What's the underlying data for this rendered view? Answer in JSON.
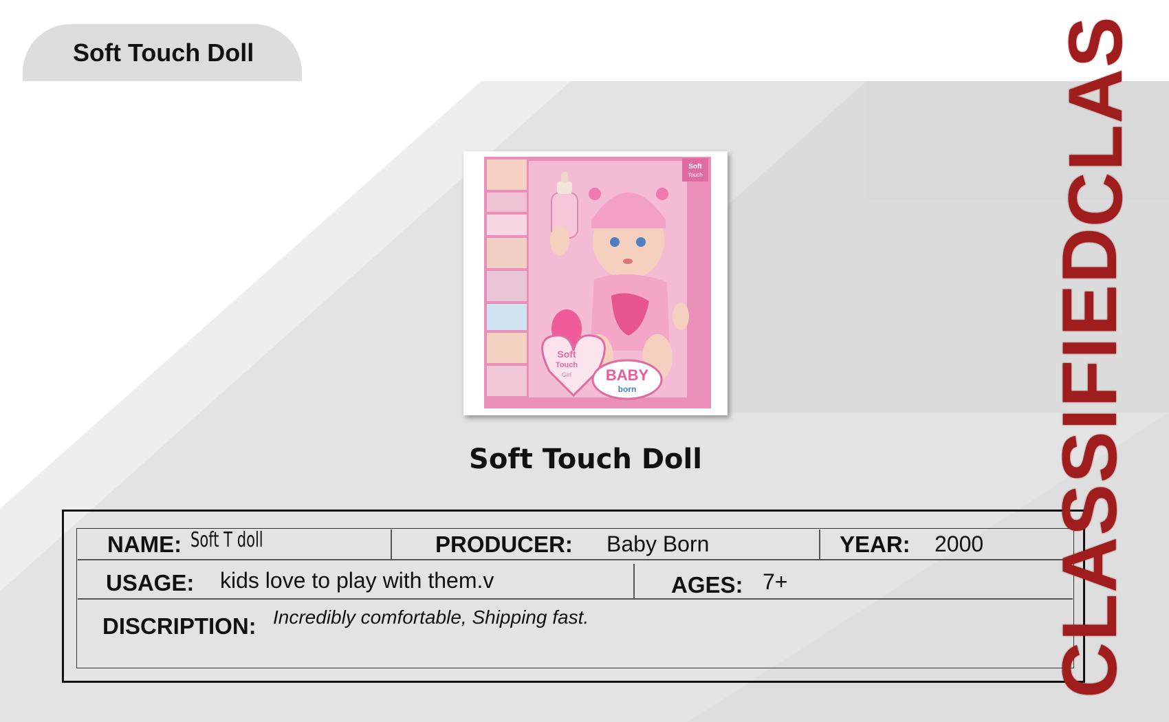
{
  "header": {
    "tab_title": "Soft Touch Doll"
  },
  "product": {
    "caption": "Soft Touch Doll",
    "box": {
      "corner_badge_line1": "Soft",
      "corner_badge_line2": "Touch",
      "heart_badge_line1": "Soft",
      "heart_badge_line2": "Touch",
      "heart_badge_line3": "Girl",
      "logo_line1": "BABY",
      "logo_line2": "born"
    }
  },
  "info": {
    "name_label": "NAME:",
    "name_value": "Soft T doll",
    "producer_label": "PRODUCER:",
    "producer_value": "Baby Born",
    "year_label": "YEAR:",
    "year_value": "2000",
    "usage_label": "USAGE:",
    "usage_value": "kids love to play with them.v",
    "ages_label": "AGES:",
    "ages_value": "7+",
    "description_label": "DISCRIPTION:",
    "description_value": "Incredibly comfortable, Shipping fast."
  },
  "stamp": {
    "main": "CLASSIFIED",
    "partial": "CLAS"
  },
  "colors": {
    "stamp_red": "#a01d1d",
    "box_pink": "#e98fb8",
    "panel_gray": "#dcdcdc"
  }
}
